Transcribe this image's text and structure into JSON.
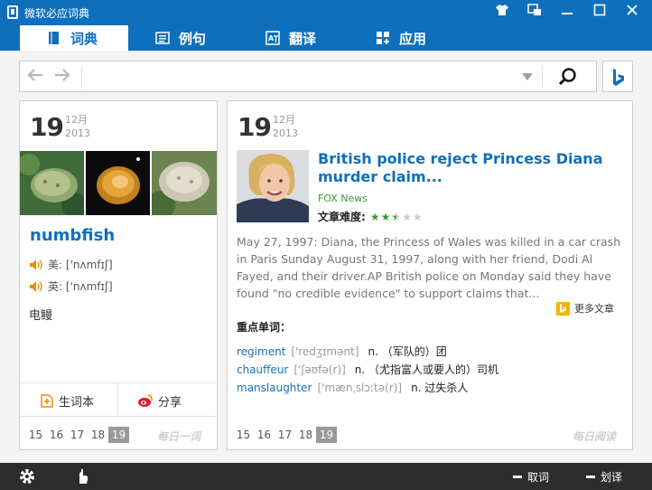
{
  "window": {
    "title": "微软必应词典"
  },
  "tabs": [
    {
      "label": "词典",
      "icon": "book-icon"
    },
    {
      "label": "例句",
      "icon": "sentence-icon"
    },
    {
      "label": "翻译",
      "icon": "translate-icon"
    },
    {
      "label": "应用",
      "icon": "apps-icon"
    }
  ],
  "search": {
    "value": "",
    "placeholder": ""
  },
  "daily_word": {
    "day": "19",
    "month": "12月",
    "year": "2013",
    "word": "numbfish",
    "pron_us_label": "美:",
    "pron_us": "['nʌmfɪʃ]",
    "pron_uk_label": "英:",
    "pron_uk": "['nʌmfɪʃ]",
    "meaning": "电鳗",
    "action_wordbook": "生词本",
    "action_share": "分享",
    "pages": [
      "15",
      "16",
      "17",
      "18",
      "19"
    ],
    "active_page": "19",
    "section_label": "每日一词"
  },
  "daily_reading": {
    "day": "19",
    "month": "12月",
    "year": "2013",
    "headline": "British police reject Princess Diana murder claim...",
    "source": "FOX News",
    "difficulty_label": "文章难度:",
    "difficulty_rating": 2.5,
    "difficulty_max": 5,
    "summary": "May 27, 1997: Diana, the Princess of Wales was killed in a car crash in Paris Sunday August 31, 1997, along with her friend, Dodi Al Fayed, and their driver.AP British police on Monday said they have found \"no credible evidence\" to support claims that...",
    "more_label": "更多文章",
    "keywords_title": "重点单词：",
    "keywords": [
      {
        "word": "regiment",
        "pron": "['redʒɪmənt]",
        "def": "n. （军队的）团"
      },
      {
        "word": "chauffeur",
        "pron": "['ʃəʊfə(r)]",
        "def": "n. （尤指富人或要人的）司机"
      },
      {
        "word": "manslaughter",
        "pron": "['mænˌslɔːtə(r)]",
        "def": "n. 过失杀人"
      }
    ],
    "pages": [
      "15",
      "16",
      "17",
      "18",
      "19"
    ],
    "active_page": "19",
    "section_label": "每日阅读"
  },
  "bottom": {
    "pick_word_label": "取词",
    "select_translate_label": "划译"
  },
  "colors": {
    "accent": "#0e6fbd",
    "star_on": "#3a9a3a",
    "star_off": "#cccccc",
    "bing_yellow": "#f6b500"
  }
}
